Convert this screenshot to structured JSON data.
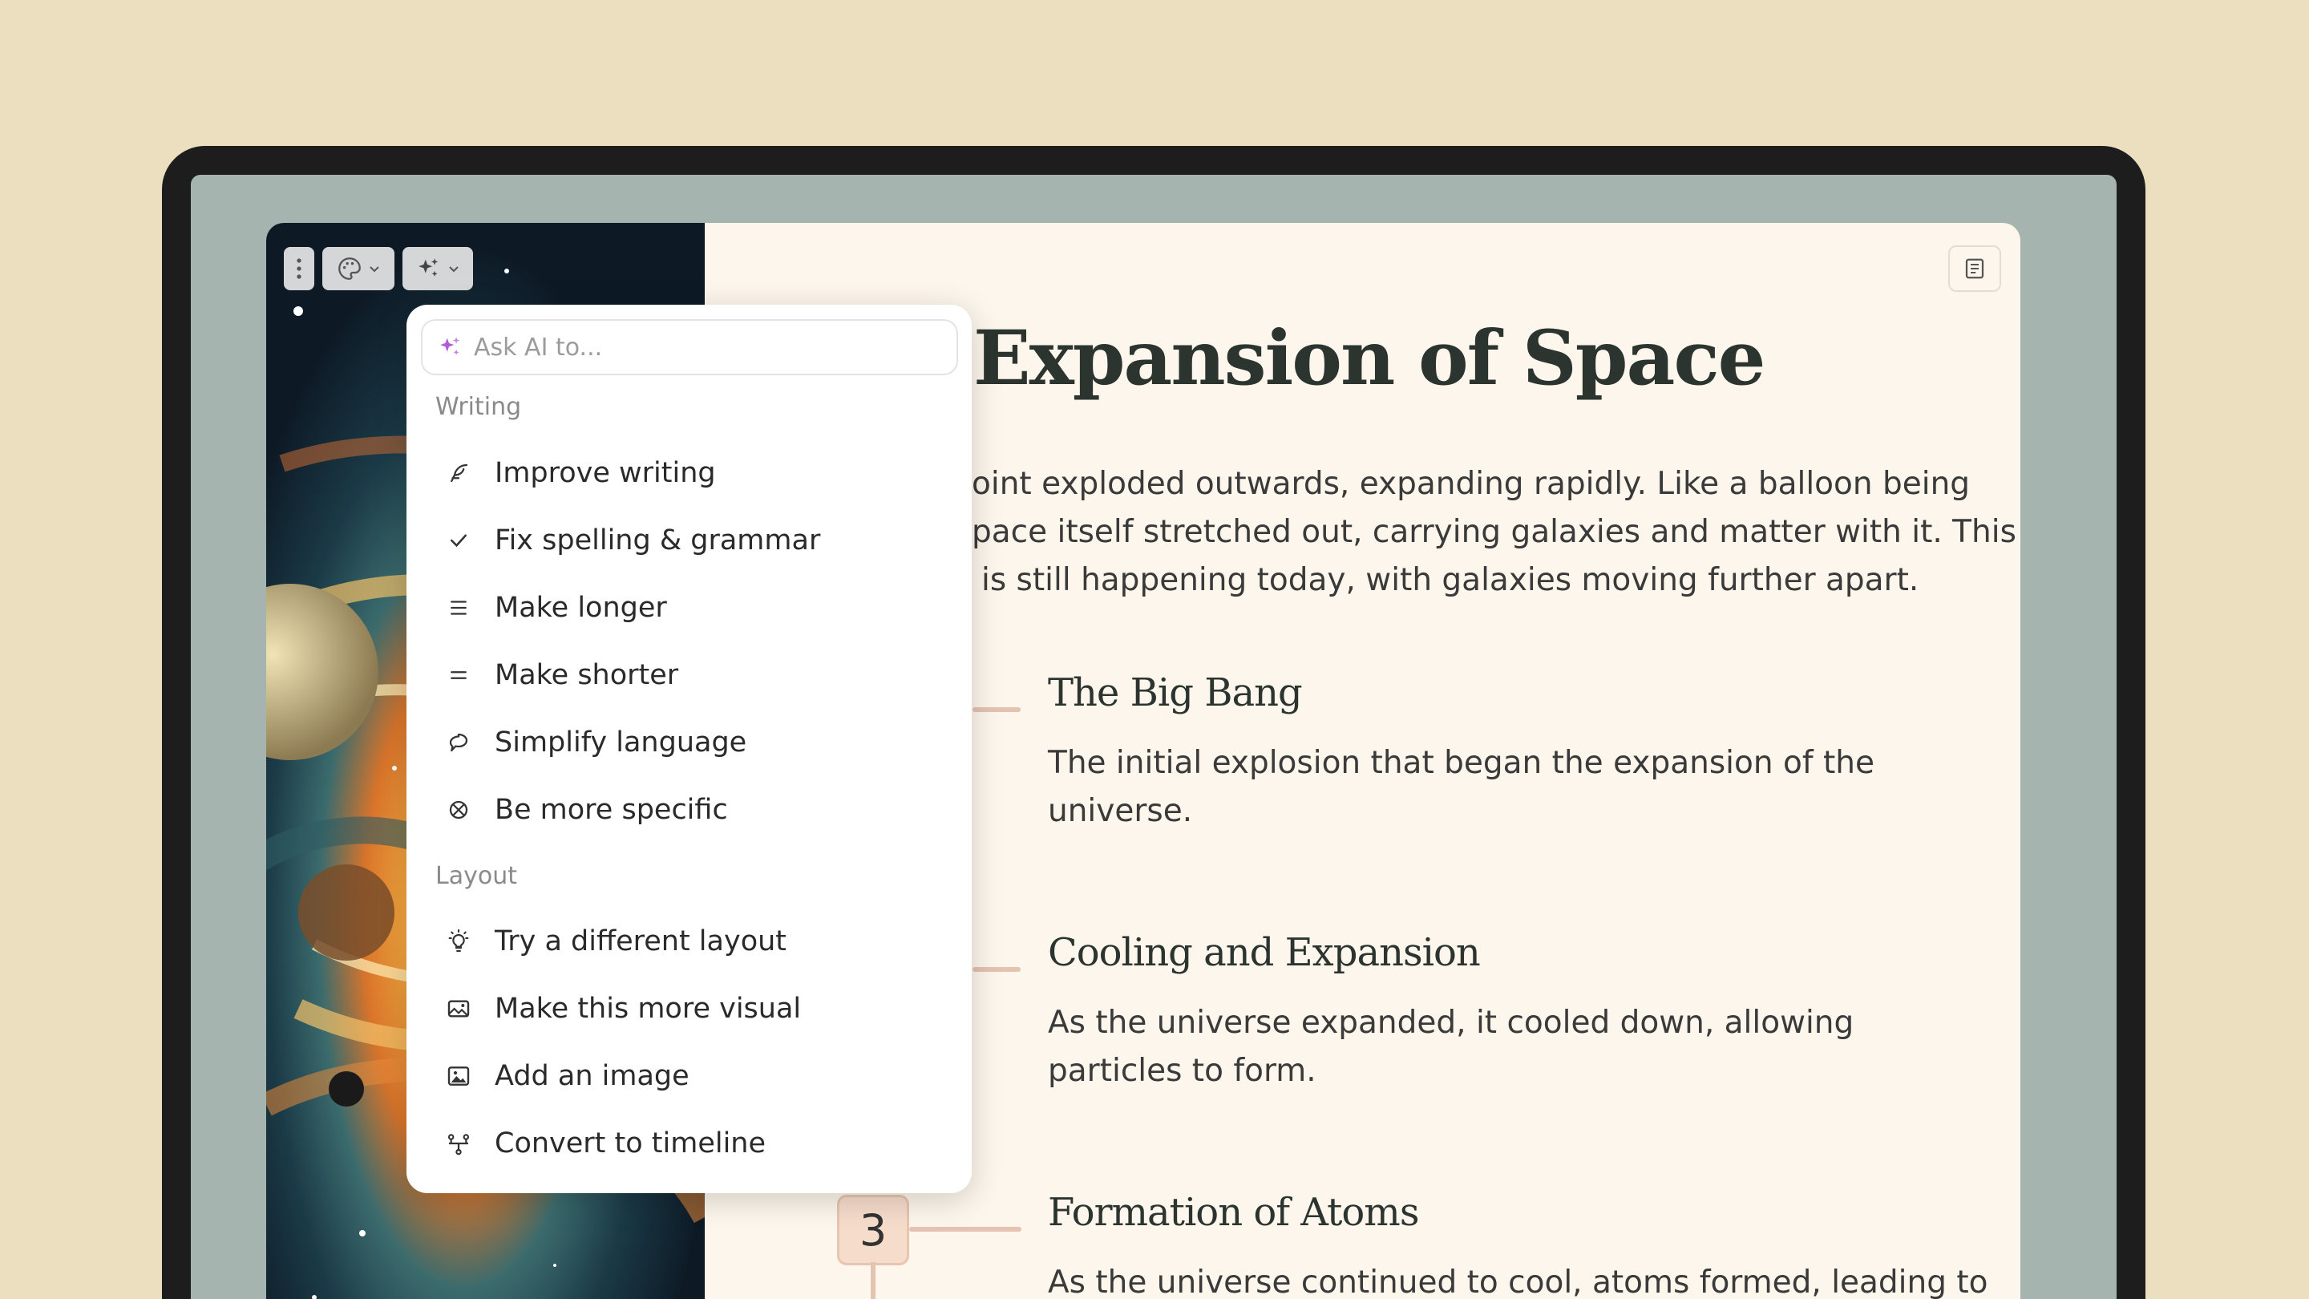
{
  "document": {
    "title": "Expansion of Space",
    "intro_lines": [
      "oint exploded outwards, expanding rapidly. Like a balloon being",
      "pace itself stretched out, carrying galaxies and matter with it. This",
      "is still happening today, with galaxies moving further apart."
    ],
    "timeline": [
      {
        "heading": "The Big Bang",
        "body": "The initial explosion that began the expansion of the universe."
      },
      {
        "heading": "Cooling and Expansion",
        "body": "As the universe expanded, it cooled down, allowing particles to form."
      },
      {
        "number": "3",
        "heading": "Formation of Atoms",
        "body": "As the universe continued to cool, atoms formed, leading to"
      }
    ]
  },
  "ai_menu": {
    "placeholder": "Ask AI to...",
    "sections": [
      {
        "label": "Writing",
        "items": [
          {
            "label": "Improve writing",
            "icon": "feather-icon"
          },
          {
            "label": "Fix spelling & grammar",
            "icon": "check-icon"
          },
          {
            "label": "Make longer",
            "icon": "lines-icon"
          },
          {
            "label": "Make shorter",
            "icon": "two-lines-icon"
          },
          {
            "label": "Simplify language",
            "icon": "speech-bubble-icon"
          },
          {
            "label": "Be more specific",
            "icon": "focus-icon"
          }
        ]
      },
      {
        "label": "Layout",
        "items": [
          {
            "label": "Try a different layout",
            "icon": "lightbulb-icon"
          },
          {
            "label": "Make this more visual",
            "icon": "gallery-icon"
          },
          {
            "label": "Add an image",
            "icon": "image-icon"
          },
          {
            "label": "Convert to timeline",
            "icon": "timeline-icon"
          }
        ]
      }
    ]
  },
  "colors": {
    "background": "#ecdfbf",
    "screen": "#a5b4ae",
    "card": "#fdf6ec",
    "accent_sparkle": "#b05cd6",
    "timeline": "#e4c3b1"
  }
}
